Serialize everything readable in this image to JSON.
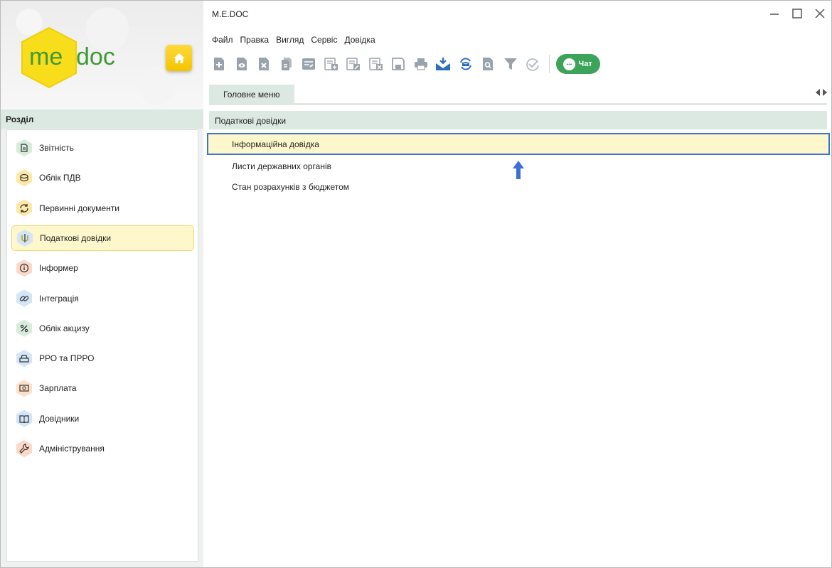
{
  "app": {
    "title": "M.E.DOC",
    "logo_me": "me",
    "logo_doc": "doc"
  },
  "colors": {
    "accent_green": "#3ba35a",
    "selection_border": "#3f74cf",
    "highlight": "#fff7cc",
    "header_bg": "#dce8e2"
  },
  "menu": [
    "Файл",
    "Правка",
    "Вигляд",
    "Сервіс",
    "Довідка"
  ],
  "toolbar": {
    "icons": [
      "new-doc-icon",
      "view-doc-icon",
      "delete-doc-icon",
      "copy-doc-icon",
      "edit-doc-icon",
      "add-doc-icon",
      "modify-doc-icon",
      "remove-doc-icon",
      "save-icon",
      "print-icon",
      "receive-icon",
      "sync-icon",
      "preview-icon",
      "filter-icon",
      "verify-icon"
    ],
    "chat_label": "Чат"
  },
  "sidebar": {
    "header": "Розділ",
    "items": [
      {
        "label": "Звітність",
        "icon": "report-icon",
        "color": "#d8ecdc"
      },
      {
        "label": "Облік ПДВ",
        "icon": "coins-icon",
        "color": "#fde8a8"
      },
      {
        "label": "Первинні документи",
        "icon": "refresh-doc-icon",
        "color": "#fde8a8"
      },
      {
        "label": "Податкові довідки",
        "icon": "trident-icon",
        "color": "#d3e5f6"
      },
      {
        "label": "Інформер",
        "icon": "info-icon",
        "color": "#fbd8c8"
      },
      {
        "label": "Інтеграція",
        "icon": "link-icon",
        "color": "#d3e5f6"
      },
      {
        "label": "Облік акцизу",
        "icon": "percent-icon",
        "color": "#d8ecdc"
      },
      {
        "label": "РРО та ПРРО",
        "icon": "cash-register-icon",
        "color": "#d3e5f6"
      },
      {
        "label": "Зарплата",
        "icon": "money-icon",
        "color": "#fde0c8"
      },
      {
        "label": "Довідники",
        "icon": "book-icon",
        "color": "#d3e5f6"
      },
      {
        "label": "Адміністрування",
        "icon": "wrench-icon",
        "color": "#fbd8c8"
      }
    ],
    "active_index": 3
  },
  "tabs": [
    {
      "label": "Головне меню"
    }
  ],
  "content": {
    "header": "Податкові довідки",
    "items": [
      "Інформаційна довідка",
      "Листи державних органів",
      "Стан розрахунків з бюджетом"
    ],
    "selected_index": 0
  }
}
